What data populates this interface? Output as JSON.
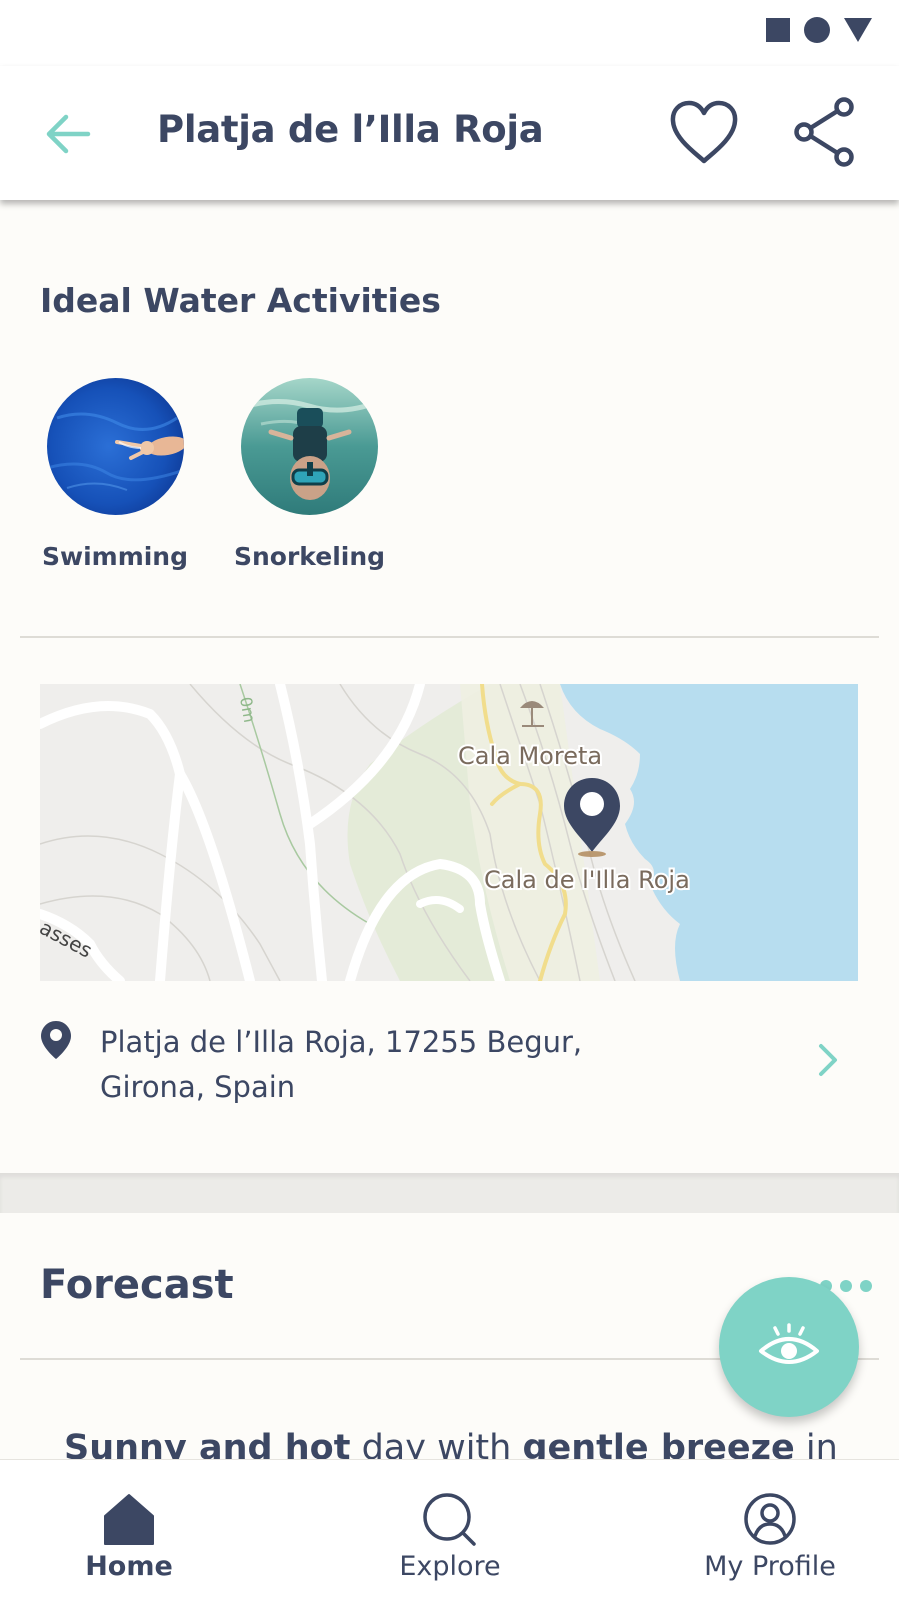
{
  "header": {
    "title": "Platja de l’Illa Roja",
    "back_icon": "arrow-left-icon",
    "favorite_icon": "heart-icon",
    "share_icon": "share-icon"
  },
  "activities": {
    "title": "Ideal Water Activities",
    "items": [
      {
        "label": "Swimming"
      },
      {
        "label": "Snorkeling"
      }
    ]
  },
  "map": {
    "labels": {
      "poi_1": "Cala Moreta",
      "poi_2": "Cala de l'Illa Roja",
      "road": "asses",
      "contour": "0m"
    }
  },
  "address": {
    "line1": "Platja de l’Illa Roja, 17255 Begur,",
    "line2": "Girona, Spain"
  },
  "forecast": {
    "title": "Forecast",
    "summary_bold_1": "Sunny and hot",
    "summary_mid": " day with ",
    "summary_bold_2": "gentle breeze",
    "summary_end": " in"
  },
  "bottom_nav": {
    "items": [
      {
        "label": "Home",
        "active": true
      },
      {
        "label": "Explore",
        "active": false
      },
      {
        "label": "My Profile",
        "active": false
      }
    ]
  },
  "colors": {
    "primary_text": "#3c4763",
    "accent": "#7fd3c6",
    "background": "#fdfcf9",
    "map_water": "#b7ddef"
  }
}
